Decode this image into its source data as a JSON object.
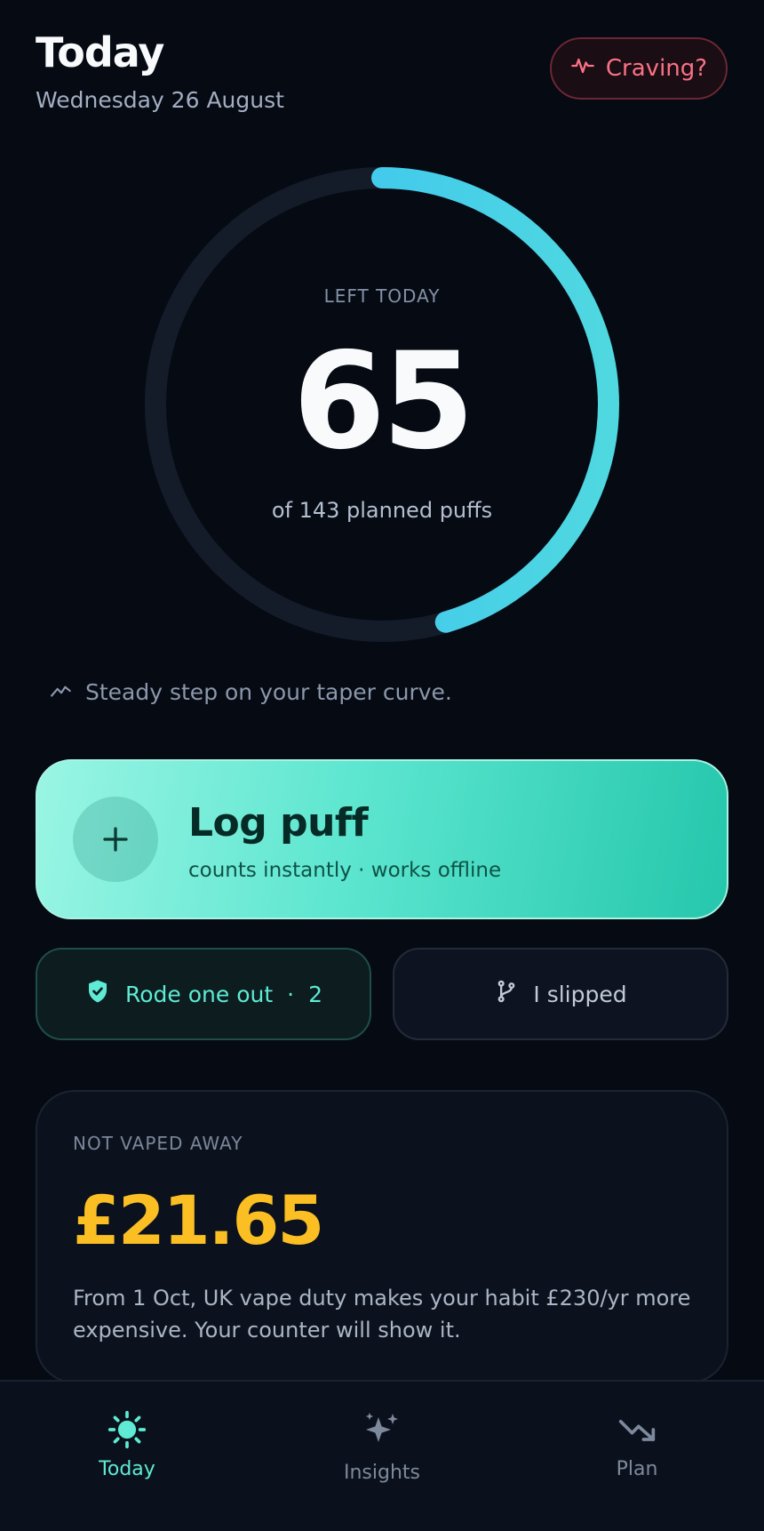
{
  "header": {
    "title": "Today",
    "date": "Wednesday 26 August",
    "craving_label": "Craving?"
  },
  "ring": {
    "label": "LEFT TODAY",
    "remaining": "65",
    "planned_text": "of 143 planned puffs",
    "remaining_value": 65,
    "planned_value": 143,
    "track_color": "#141c2a",
    "progress_color": "#38bdf8"
  },
  "trend": {
    "icon": "trend-line-icon",
    "text": "Steady step on your taper curve."
  },
  "log_button": {
    "icon": "plus-icon",
    "title": "Log puff",
    "subtitle": "counts instantly · works offline"
  },
  "actions": {
    "rode_out": {
      "icon": "shield-check-icon",
      "label": "Rode one out",
      "separator": "·",
      "count": "2"
    },
    "slipped": {
      "icon": "git-branch-icon",
      "label": "I slipped"
    }
  },
  "savings": {
    "label": "NOT VAPED AWAY",
    "amount": "£21.65",
    "note": "From 1 Oct, UK vape duty makes your habit £230/yr more expensive. Your counter will show it.",
    "amount_color": "#fbbf24"
  },
  "tabs": [
    {
      "label": "Today",
      "icon": "sun-icon",
      "active": true
    },
    {
      "label": "Insights",
      "icon": "sparkles-icon",
      "active": false
    },
    {
      "label": "Plan",
      "icon": "trending-down-icon",
      "active": false
    }
  ],
  "colors": {
    "background": "#060a13",
    "accent": "#5eead4",
    "danger": "#fb7185"
  }
}
